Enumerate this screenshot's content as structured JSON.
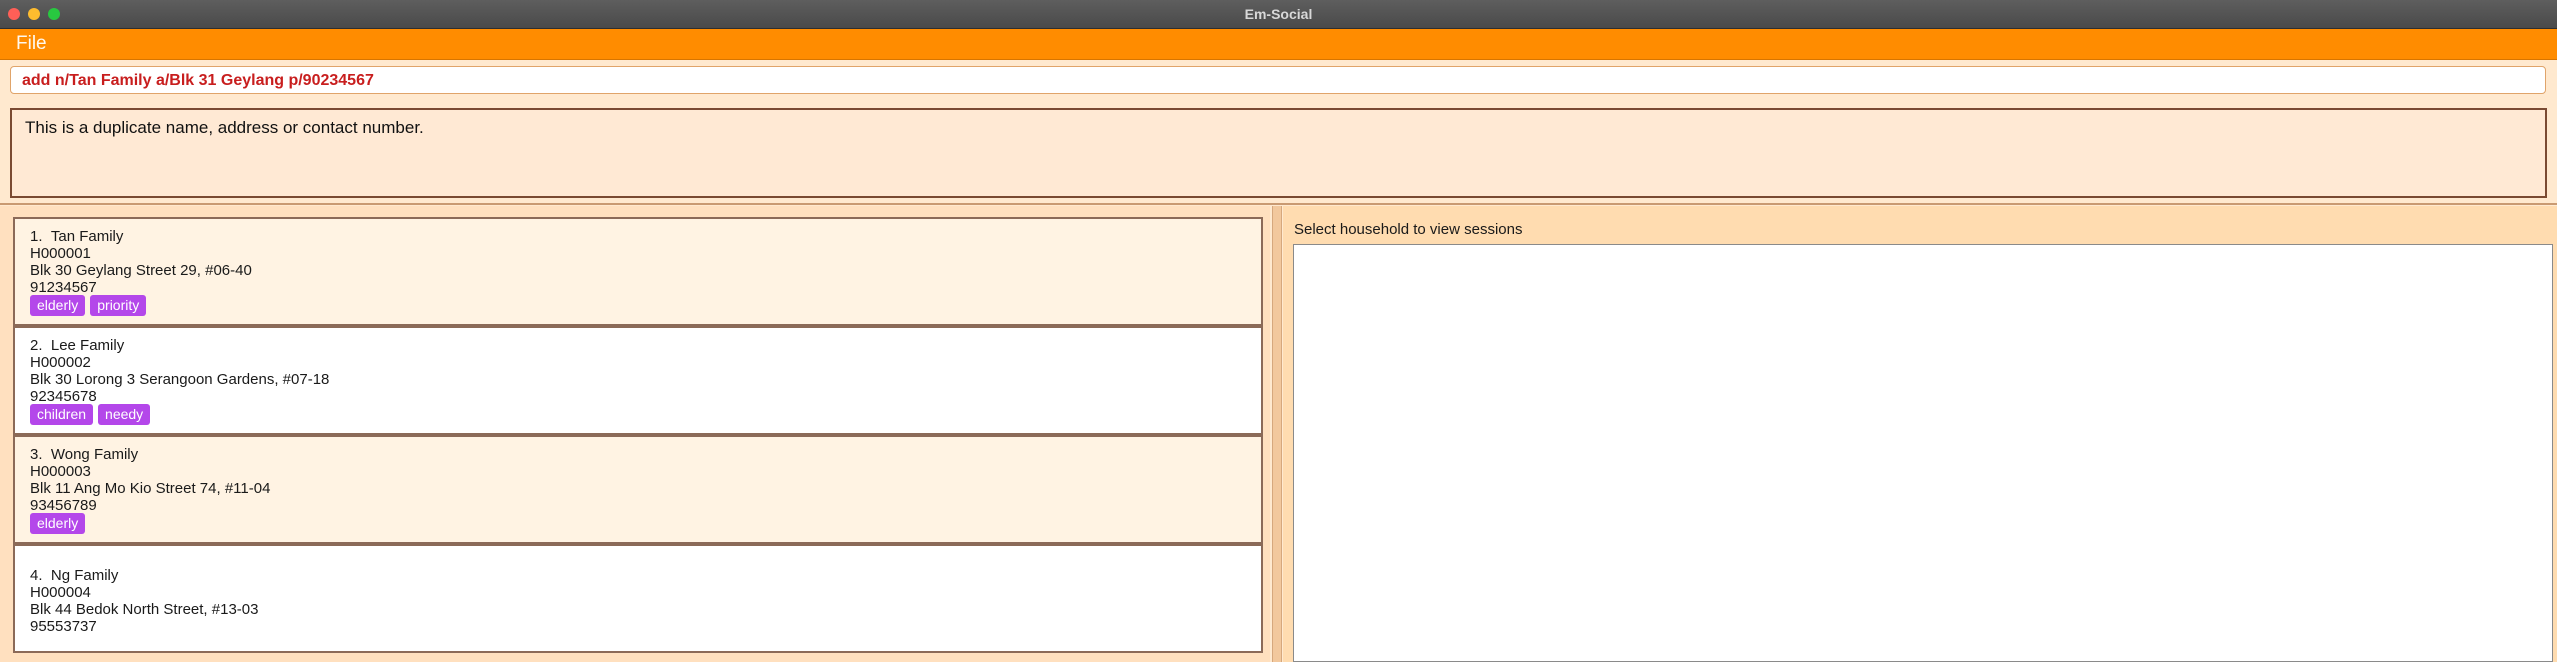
{
  "window": {
    "title": "Em-Social"
  },
  "menu": {
    "file_label": "File"
  },
  "command": {
    "value": "add n/Tan Family a/Blk 31 Geylang p/90234567"
  },
  "result": {
    "message": "This is a duplicate name, address or contact number."
  },
  "households": [
    {
      "index": "1.",
      "name": "Tan Family",
      "id": "H000001",
      "address": "Blk 30 Geylang Street 29, #06-40",
      "phone": "91234567",
      "tags": [
        "elderly",
        "priority"
      ]
    },
    {
      "index": "2.",
      "name": "Lee Family",
      "id": "H000002",
      "address": "Blk 30 Lorong 3 Serangoon Gardens, #07-18",
      "phone": "92345678",
      "tags": [
        "children",
        "needy"
      ]
    },
    {
      "index": "3.",
      "name": "Wong Family",
      "id": "H000003",
      "address": "Blk 11 Ang Mo Kio Street 74, #11-04",
      "phone": "93456789",
      "tags": [
        "elderly"
      ]
    },
    {
      "index": "4.",
      "name": "Ng Family",
      "id": "H000004",
      "address": "Blk 44 Bedok North Street, #13-03",
      "phone": "95553737",
      "tags": []
    }
  ],
  "sessions": {
    "label": "Select household to view sessions"
  },
  "colors": {
    "accent": "#ff8c00",
    "tag": "#b447ea",
    "command_text": "#c81e1e"
  }
}
